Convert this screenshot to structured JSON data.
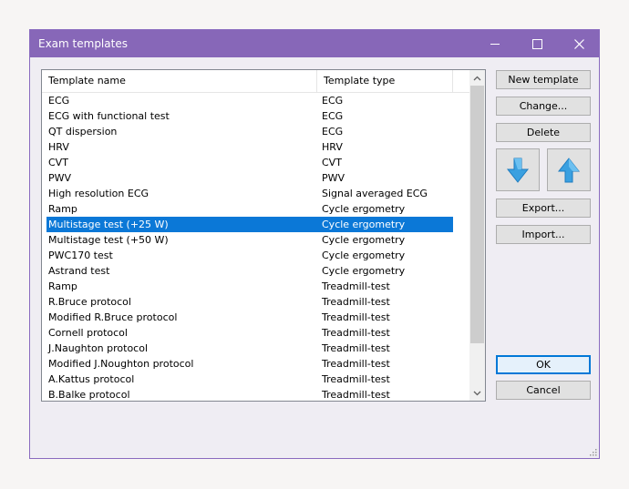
{
  "window": {
    "title": "Exam templates"
  },
  "table": {
    "headers": [
      "Template name",
      "Template type"
    ],
    "selected_index": 8,
    "rows": [
      {
        "name": "ECG",
        "type": "ECG"
      },
      {
        "name": "ECG with functional test",
        "type": "ECG"
      },
      {
        "name": "QT dispersion",
        "type": "ECG"
      },
      {
        "name": "HRV",
        "type": "HRV"
      },
      {
        "name": "CVT",
        "type": "CVT"
      },
      {
        "name": "PWV",
        "type": "PWV"
      },
      {
        "name": "High resolution ECG",
        "type": "Signal averaged ECG"
      },
      {
        "name": "Ramp",
        "type": "Cycle ergometry"
      },
      {
        "name": "Multistage test (+25 W)",
        "type": "Cycle ergometry"
      },
      {
        "name": "Multistage test (+50 W)",
        "type": "Cycle ergometry"
      },
      {
        "name": "PWC170 test",
        "type": "Cycle ergometry"
      },
      {
        "name": "Astrand test",
        "type": "Cycle ergometry"
      },
      {
        "name": "Ramp",
        "type": "Treadmill-test"
      },
      {
        "name": "R.Bruce protocol",
        "type": "Treadmill-test"
      },
      {
        "name": "Modified R.Bruce protocol",
        "type": "Treadmill-test"
      },
      {
        "name": "Cornell protocol",
        "type": "Treadmill-test"
      },
      {
        "name": "J.Naughton protocol",
        "type": "Treadmill-test"
      },
      {
        "name": "Modified J.Noughton protocol",
        "type": "Treadmill-test"
      },
      {
        "name": "A.Kattus protocol",
        "type": "Treadmill-test"
      },
      {
        "name": "B.Balke protocol",
        "type": "Treadmill-test"
      }
    ]
  },
  "buttons": {
    "new_template": "New template",
    "change": "Change...",
    "delete": "Delete",
    "move_down_icon": "arrow-down-icon",
    "move_up_icon": "arrow-up-icon",
    "export": "Export...",
    "import": "Import...",
    "ok": "OK",
    "cancel": "Cancel"
  },
  "colors": {
    "titlebar": "#8767b8",
    "selection": "#0b78d7",
    "arrow_icon": "#3aa0e0"
  }
}
